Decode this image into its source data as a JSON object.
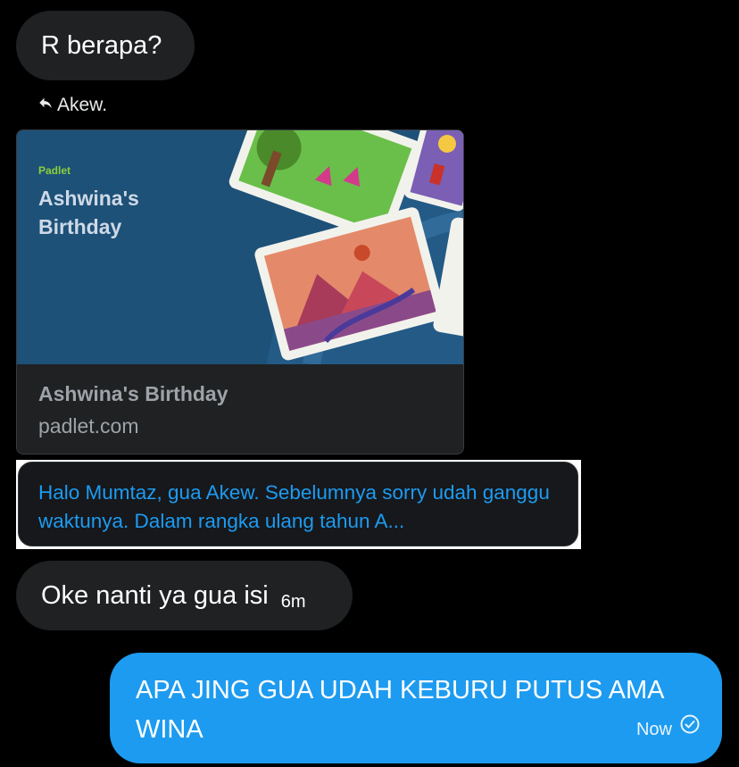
{
  "messages": {
    "first": {
      "text": "R berapa?"
    },
    "reply_to": {
      "label": "Akew."
    },
    "link_card": {
      "image_brand": "Padlet",
      "image_title": "Ashwina's Birthday",
      "title": "Ashwina's Birthday",
      "domain": "padlet.com"
    },
    "quoted": {
      "text": "Halo Mumtaz, gua Akew. Sebelumnya sorry udah ganggu waktunya. Dalam rangka ulang tahun A..."
    },
    "second": {
      "text": "Oke nanti ya gua isi",
      "time": "6m"
    },
    "sent": {
      "text": "APA JING GUA UDAH KEBURU PUTUS AMA WINA",
      "status": "Now"
    }
  },
  "icons": {
    "reply": "reply-arrow-icon",
    "sent": "check-circle-icon"
  },
  "colors": {
    "background": "#000000",
    "incoming_bubble": "#1f2123",
    "outgoing_bubble": "#1d9bf0",
    "link": "#1d9bf0",
    "card_image_bg": "#1d5178"
  }
}
